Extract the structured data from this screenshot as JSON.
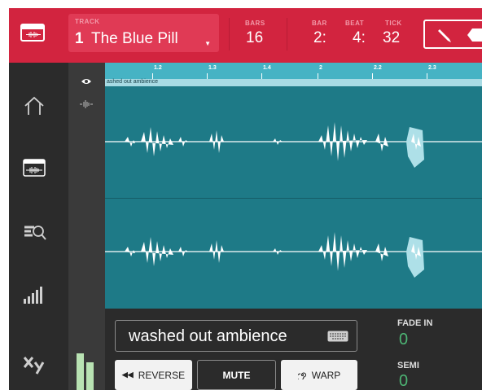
{
  "header": {
    "track_label": "TRACK",
    "track_number": "1",
    "track_name": "The Blue Pill",
    "bars_label": "BARS",
    "bars_value": "16",
    "bar_label": "BAR",
    "bar_value": "2:",
    "beat_label": "BEAT",
    "beat_value": "4:",
    "tick_label": "TICK",
    "tick_value": "32"
  },
  "ruler": {
    "ticks": [
      "1.2",
      "1.3",
      "1.4",
      "2",
      "2.2",
      "2.3"
    ]
  },
  "region": {
    "name": "ashed out ambience"
  },
  "sample": {
    "name": "washed out ambience"
  },
  "buttons": {
    "reverse": "REVERSE",
    "mute": "MUTE",
    "warp": "WARP"
  },
  "params": {
    "fade_in_label": "FADE IN",
    "fade_in_value": "0",
    "semi_label": "SEMI",
    "semi_value": "0"
  },
  "colors": {
    "header": "#d2243f",
    "waveform_bg": "#1e7a87",
    "ruler": "#46b3c4",
    "value_green": "#4db574"
  },
  "icons": {
    "sidebar": [
      "home-icon",
      "track-edit-icon",
      "browse-icon",
      "levels-icon",
      "xy-icon"
    ],
    "header": [
      "track-edit-icon",
      "pencil-icon",
      "eraser-icon"
    ]
  }
}
